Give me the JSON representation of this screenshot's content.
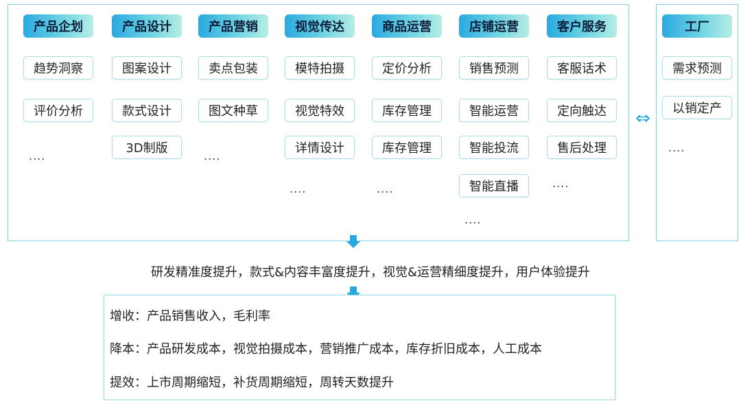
{
  "columns": [
    {
      "header": "产品企划",
      "items": [
        "趋势洞察",
        "评价分析"
      ],
      "more": "...."
    },
    {
      "header": "产品设计",
      "items": [
        "图案设计",
        "款式设计",
        "3D制版"
      ],
      "more": ""
    },
    {
      "header": "产品营销",
      "items": [
        "卖点包装",
        "图文种草"
      ],
      "more": "...."
    },
    {
      "header": "视觉传达",
      "items": [
        "模特拍摄",
        "视觉特效",
        "详情设计"
      ],
      "more": "...."
    },
    {
      "header": "商品运营",
      "items": [
        "定价分析",
        "库存管理",
        "库存管理"
      ],
      "more": "...."
    },
    {
      "header": "店铺运营",
      "items": [
        "销售预测",
        "智能运营",
        "智能投流",
        "智能直播"
      ],
      "more": "...."
    },
    {
      "header": "客户服务",
      "items": [
        "客服话术",
        "定向触达",
        "售后处理"
      ],
      "more": "...."
    }
  ],
  "factory": {
    "header": "工厂",
    "items": [
      "需求预测",
      "以销定产"
    ],
    "more": "...."
  },
  "bidirectional_arrow": "⇔",
  "summary": "研发精准度提升，款式&内容丰富度提升，视觉&运营精细度提升，用户体验提升",
  "results": [
    "增收：产品销售收入，毛利率",
    "降本：产品研发成本，视觉拍摄成本，营销推广成本，库存折旧成本，人工成本",
    "提效：上市周期缩短，补货周期缩短，周转天数提升"
  ],
  "colors": {
    "accent": "#29a8de",
    "border": "#7fd0e2"
  }
}
